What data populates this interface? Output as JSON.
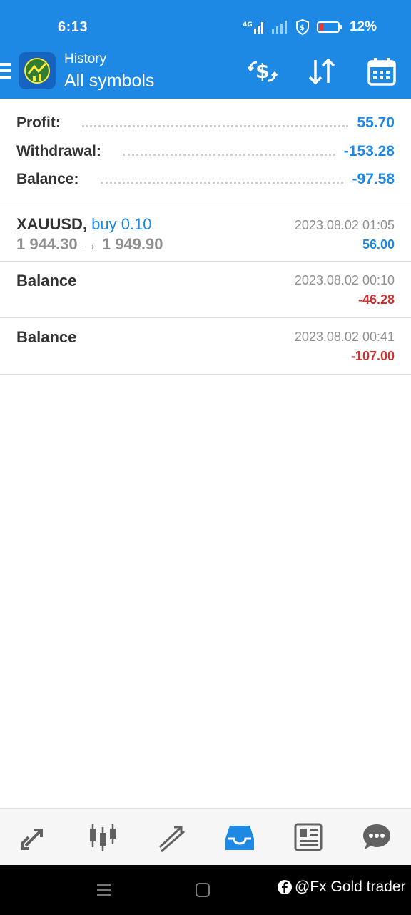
{
  "status": {
    "time": "6:13",
    "network": "4G",
    "battery_pct": "12%"
  },
  "app": {
    "subtitle": "History",
    "title": "All symbols",
    "icons": [
      "currency-exchange-icon",
      "sort-icon",
      "calendar-icon"
    ]
  },
  "summary": {
    "profit_label": "Profit:",
    "profit_value": "55.70",
    "withdrawal_label": "Withdrawal:",
    "withdrawal_value": "-153.28",
    "balance_label": "Balance:",
    "balance_value": "-97.58"
  },
  "history": [
    {
      "symbol": "XAUUSD,",
      "type": "buy 0.10",
      "prices": "1 944.30 → 1 949.90",
      "date": "2023.08.02 01:05",
      "profit": "56.00"
    },
    {
      "symbol": "Balance",
      "date": "2023.08.02 00:10",
      "profit": "-46.28"
    },
    {
      "symbol": "Balance",
      "date": "2023.08.02 00:41",
      "profit": "-107.00"
    }
  ],
  "bottom_nav": {
    "items": [
      "quotes-icon",
      "chart-icon",
      "trade-icon",
      "history-icon",
      "news-icon",
      "chat-icon"
    ],
    "active": "history-icon"
  },
  "watermark": {
    "text": "@Fx Gold trader",
    "icon": "facebook-icon"
  },
  "colors": {
    "primary": "#1e88e5",
    "negative": "#d32f2f",
    "text": "#333333",
    "muted": "#8f8f8f"
  }
}
